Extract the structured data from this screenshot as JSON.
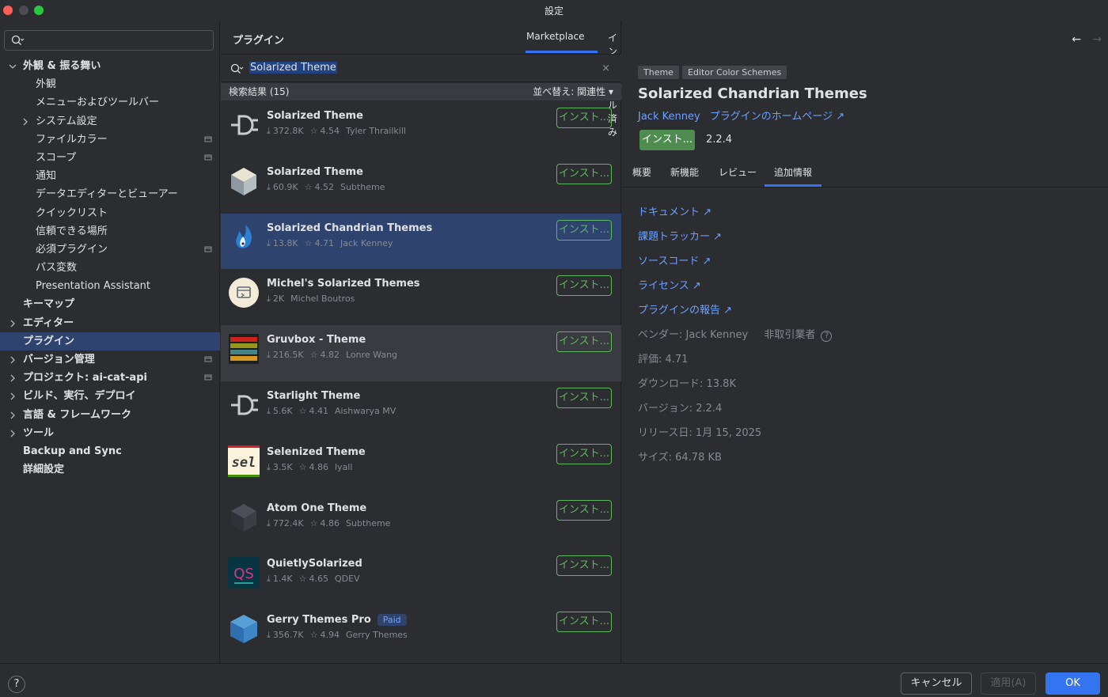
{
  "window": {
    "title": "設定"
  },
  "sidebar": {
    "search_value": "",
    "items": [
      {
        "label": "外観 & 振る舞い",
        "level": 0,
        "chevron": "down",
        "proj": false
      },
      {
        "label": "外観",
        "level": 1,
        "chevron": "",
        "proj": false
      },
      {
        "label": "メニューおよびツールバー",
        "level": 1,
        "chevron": "",
        "proj": false
      },
      {
        "label": "システム設定",
        "level": 1,
        "chevron": "right",
        "proj": false
      },
      {
        "label": "ファイルカラー",
        "level": 1,
        "chevron": "",
        "proj": true
      },
      {
        "label": "スコープ",
        "level": 1,
        "chevron": "",
        "proj": true
      },
      {
        "label": "通知",
        "level": 1,
        "chevron": "",
        "proj": false
      },
      {
        "label": "データエディターとビューアー",
        "level": 1,
        "chevron": "",
        "proj": false
      },
      {
        "label": "クイックリスト",
        "level": 1,
        "chevron": "",
        "proj": false
      },
      {
        "label": "信頼できる場所",
        "level": 1,
        "chevron": "",
        "proj": false
      },
      {
        "label": "必須プラグイン",
        "level": 1,
        "chevron": "",
        "proj": true
      },
      {
        "label": "パス変数",
        "level": 1,
        "chevron": "",
        "proj": false
      },
      {
        "label": "Presentation Assistant",
        "level": 1,
        "chevron": "",
        "proj": false
      },
      {
        "label": "キーマップ",
        "level": 0,
        "chevron": "",
        "proj": false
      },
      {
        "label": "エディター",
        "level": 0,
        "chevron": "right",
        "proj": false
      },
      {
        "label": "プラグイン",
        "level": 0,
        "chevron": "",
        "proj": false,
        "selected": true
      },
      {
        "label": "バージョン管理",
        "level": 0,
        "chevron": "right",
        "proj": true
      },
      {
        "label": "プロジェクト: ai-cat-api",
        "level": 0,
        "chevron": "right",
        "proj": true
      },
      {
        "label": "ビルド、実行、デプロイ",
        "level": 0,
        "chevron": "right",
        "proj": false
      },
      {
        "label": "言語 & フレームワーク",
        "level": 0,
        "chevron": "right",
        "proj": false
      },
      {
        "label": "ツール",
        "level": 0,
        "chevron": "right",
        "proj": false
      },
      {
        "label": "Backup and Sync",
        "level": 0,
        "chevron": "",
        "proj": false
      },
      {
        "label": "詳細設定",
        "level": 0,
        "chevron": "",
        "proj": false
      }
    ]
  },
  "plugins_panel": {
    "title": "プラグイン",
    "tabs": {
      "marketplace": "Marketplace",
      "installed": "インストール済み"
    },
    "search": {
      "value": "Solarized Theme",
      "clear": "×"
    },
    "results": {
      "count_label": "検索結果 (15)",
      "sort_label": "並べ替え: 関連性"
    },
    "install_label": "インスト...",
    "paid_label": "Paid",
    "items": [
      {
        "name": "Solarized Theme",
        "downloads": "372.8K",
        "rating": "4.54",
        "vendor": "Tyler Thrailkill",
        "icon": "plug-icon",
        "state": ""
      },
      {
        "name": "Solarized Theme",
        "downloads": "60.9K",
        "rating": "4.52",
        "vendor": "Subtheme",
        "icon": "cube-light-icon",
        "state": ""
      },
      {
        "name": "Solarized Chandrian Themes",
        "downloads": "13.8K",
        "rating": "4.71",
        "vendor": "Jack Kenney",
        "icon": "flame-icon",
        "state": "selected"
      },
      {
        "name": "Michel's Solarized Themes",
        "downloads": "2K",
        "rating": "",
        "vendor": "Michel Boutros",
        "icon": "michel-logo-icon",
        "state": ""
      },
      {
        "name": "Gruvbox - Theme",
        "downloads": "216.5K",
        "rating": "4.82",
        "vendor": "Lonre Wang",
        "icon": "stripes-icon",
        "state": "hover"
      },
      {
        "name": "Starlight Theme",
        "downloads": "5.6K",
        "rating": "4.41",
        "vendor": "Aishwarya MV",
        "icon": "plug-icon",
        "state": ""
      },
      {
        "name": "Selenized Theme",
        "downloads": "3.5K",
        "rating": "4.86",
        "vendor": "lyall",
        "icon": "sel-logo-icon",
        "state": ""
      },
      {
        "name": "Atom One Theme",
        "downloads": "772.4K",
        "rating": "4.86",
        "vendor": "Subtheme",
        "icon": "cube-dark-icon",
        "state": ""
      },
      {
        "name": "QuietlySolarized",
        "downloads": "1.4K",
        "rating": "4.65",
        "vendor": "QDEV",
        "icon": "qs-logo-icon",
        "state": ""
      },
      {
        "name": "Gerry Themes Pro",
        "downloads": "356.7K",
        "rating": "4.94",
        "vendor": "Gerry Themes",
        "icon": "gerry-cube-icon",
        "state": "",
        "paid": true
      }
    ]
  },
  "detail": {
    "tags": [
      "Theme",
      "Editor Color Schemes"
    ],
    "title": "Solarized Chandrian Themes",
    "vendor_link": "Jack Kenney",
    "homepage_link": "プラグインのホームページ ↗",
    "install_label": "インスト...",
    "version": "2.2.4",
    "tabs": [
      "概要",
      "新機能",
      "レビュー",
      "追加情報"
    ],
    "active_tab": "追加情報",
    "links": [
      "ドキュメント ↗",
      "課題トラッカー ↗",
      "ソースコード ↗",
      "ライセンス ↗",
      "プラグインの報告 ↗"
    ],
    "vendor_line": "ベンダー: Jack Kenney",
    "vendor_type": "非取引業者",
    "rating_line": "評価: 4.71",
    "downloads_line": "ダウンロード: 13.8K",
    "version_line": "バージョン: 2.2.4",
    "release_line": "リリース日: 1月 15, 2025",
    "size_line": "サイズ: 64.78 KB"
  },
  "footer": {
    "help": "?",
    "cancel": "キャンセル",
    "apply": "適用(A)",
    "ok": "OK"
  },
  "colors": {
    "accent": "#3574f0",
    "install_green": "#5fb85f",
    "link": "#6ea0ff",
    "selection": "#2e436e"
  }
}
